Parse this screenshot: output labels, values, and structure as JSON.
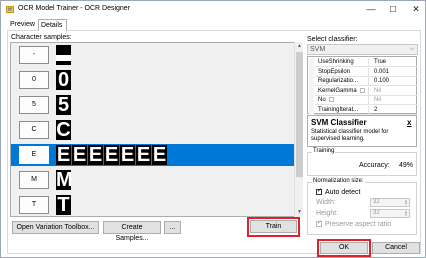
{
  "window": {
    "title": "OCR Model Trainer - OCR Designer",
    "controls": {
      "minimize": "—",
      "maximize": "☐",
      "close": "✕"
    }
  },
  "tabs": [
    {
      "label": "Preview"
    },
    {
      "label": "Details"
    }
  ],
  "samples": {
    "label": "Character samples:",
    "rows": [
      {
        "char": "-",
        "glyphs": [
          "▬"
        ],
        "selected": false
      },
      {
        "char": "0",
        "glyphs": [
          "0"
        ],
        "selected": false
      },
      {
        "char": "5",
        "glyphs": [
          "5"
        ],
        "selected": false
      },
      {
        "char": "C",
        "glyphs": [
          "C"
        ],
        "selected": false
      },
      {
        "char": "E",
        "glyphs": [
          "E",
          "E",
          "E",
          "E",
          "E",
          "E",
          "E"
        ],
        "selected": true
      },
      {
        "char": "M",
        "glyphs": [
          "M"
        ],
        "selected": false
      },
      {
        "char": "T",
        "glyphs": [
          "T"
        ],
        "selected": false
      }
    ]
  },
  "buttons": {
    "variation_toolbox": "Open Variation Toolbox...",
    "create_samples": "Create Samples...",
    "more": "...",
    "train": "Train",
    "ok": "OK",
    "cancel": "Cancel"
  },
  "classifier": {
    "label": "Select classifier:",
    "selected": "SVM",
    "properties": [
      {
        "name": "UseShrinking",
        "value": "True",
        "checkbox": false,
        "disabled": false
      },
      {
        "name": "StopEpsilon",
        "value": "0.001",
        "checkbox": false,
        "disabled": false
      },
      {
        "name": "Regularizatio...",
        "value": "0.100",
        "checkbox": false,
        "disabled": false
      },
      {
        "name": "KernelGamma",
        "value": "Nil",
        "checkbox": true,
        "disabled": true
      },
      {
        "name": "Nu",
        "value": "Nil",
        "checkbox": true,
        "disabled": true
      },
      {
        "name": "TrainingIterat...",
        "value": "2",
        "checkbox": false,
        "disabled": false
      }
    ],
    "description_title": "SVM Classifier",
    "description_text": "Statistical classifier model for supervised learning.",
    "description_close": "x"
  },
  "training": {
    "legend": "Training",
    "accuracy_label": "Accuracy:",
    "accuracy_value": "49%"
  },
  "normalization": {
    "legend": "Normalization size:",
    "auto_detect": "Auto detect",
    "width_label": "Width:",
    "width_value": "32",
    "height_label": "Height:",
    "height_value": "32",
    "preserve_aspect": "Preserve aspect ratio"
  },
  "colors": {
    "selection": "#0078d7",
    "highlight": "#e0202a"
  }
}
